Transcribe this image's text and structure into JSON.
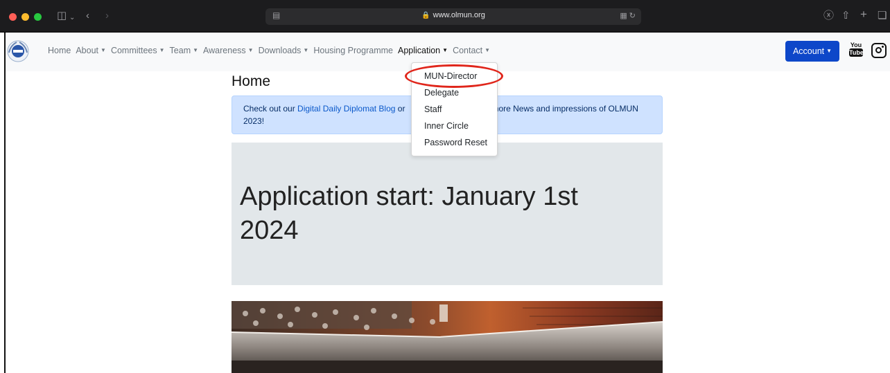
{
  "browser": {
    "url": "www.olmun.org"
  },
  "nav": {
    "items": [
      {
        "label": "Home",
        "caret": false
      },
      {
        "label": "About",
        "caret": true
      },
      {
        "label": "Committees",
        "caret": true
      },
      {
        "label": "Team",
        "caret": true
      },
      {
        "label": "Awareness",
        "caret": true
      },
      {
        "label": "Downloads",
        "caret": true
      },
      {
        "label": "Housing Programme",
        "caret": false
      },
      {
        "label": "Application",
        "caret": true
      },
      {
        "label": "Contact",
        "caret": true
      }
    ],
    "account_label": "Account",
    "youtube_top": "You",
    "youtube_bottom": "Tube"
  },
  "dropdown": {
    "items": [
      "MUN-Director",
      "Delegate",
      "Staff",
      "Inner Circle",
      "Password Reset"
    ],
    "highlighted": "MUN-Director"
  },
  "page": {
    "heading": "Home",
    "alert_prefix": "Check out our ",
    "alert_link": "Digital Daily Diplomat Blog",
    "alert_middle": " or",
    "alert_suffix": "more News and impressions of OLMUN",
    "alert_line2": "2023!",
    "jumbotron_title": "Application start: January 1st 2024"
  },
  "colors": {
    "accent": "#0d47c9",
    "highlight_ring": "#e0261b",
    "alert_bg": "#cfe2ff",
    "jumbotron_bg": "#e2e7ea"
  }
}
